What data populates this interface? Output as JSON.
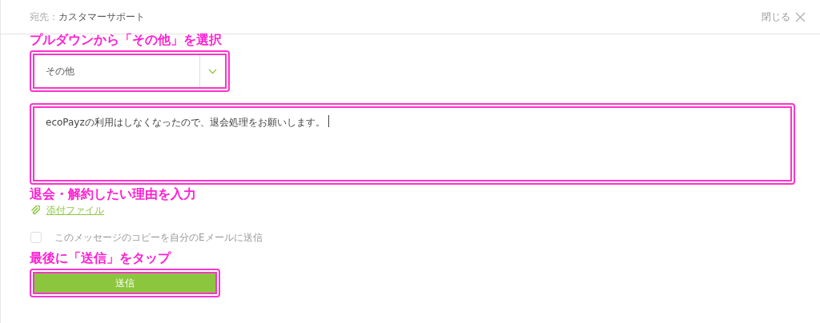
{
  "header": {
    "to_label": "宛先：",
    "to_value": "カスタマーサポート",
    "close_label": "閉じる"
  },
  "annotations": [
    "プルダウンから「その他」を選択",
    "退会・解約したい理由を入力",
    "最後に「送信」をタップ"
  ],
  "category_select": {
    "value": "その他"
  },
  "message": {
    "value": "ecoPayzの利用はしなくなったので、退会処理をお願いします。"
  },
  "attachment_link": "添付ファイル",
  "copy_checkbox": {
    "label": "このメッセージのコピーを自分のEメールに送信",
    "checked": false
  },
  "submit_button": "送信"
}
